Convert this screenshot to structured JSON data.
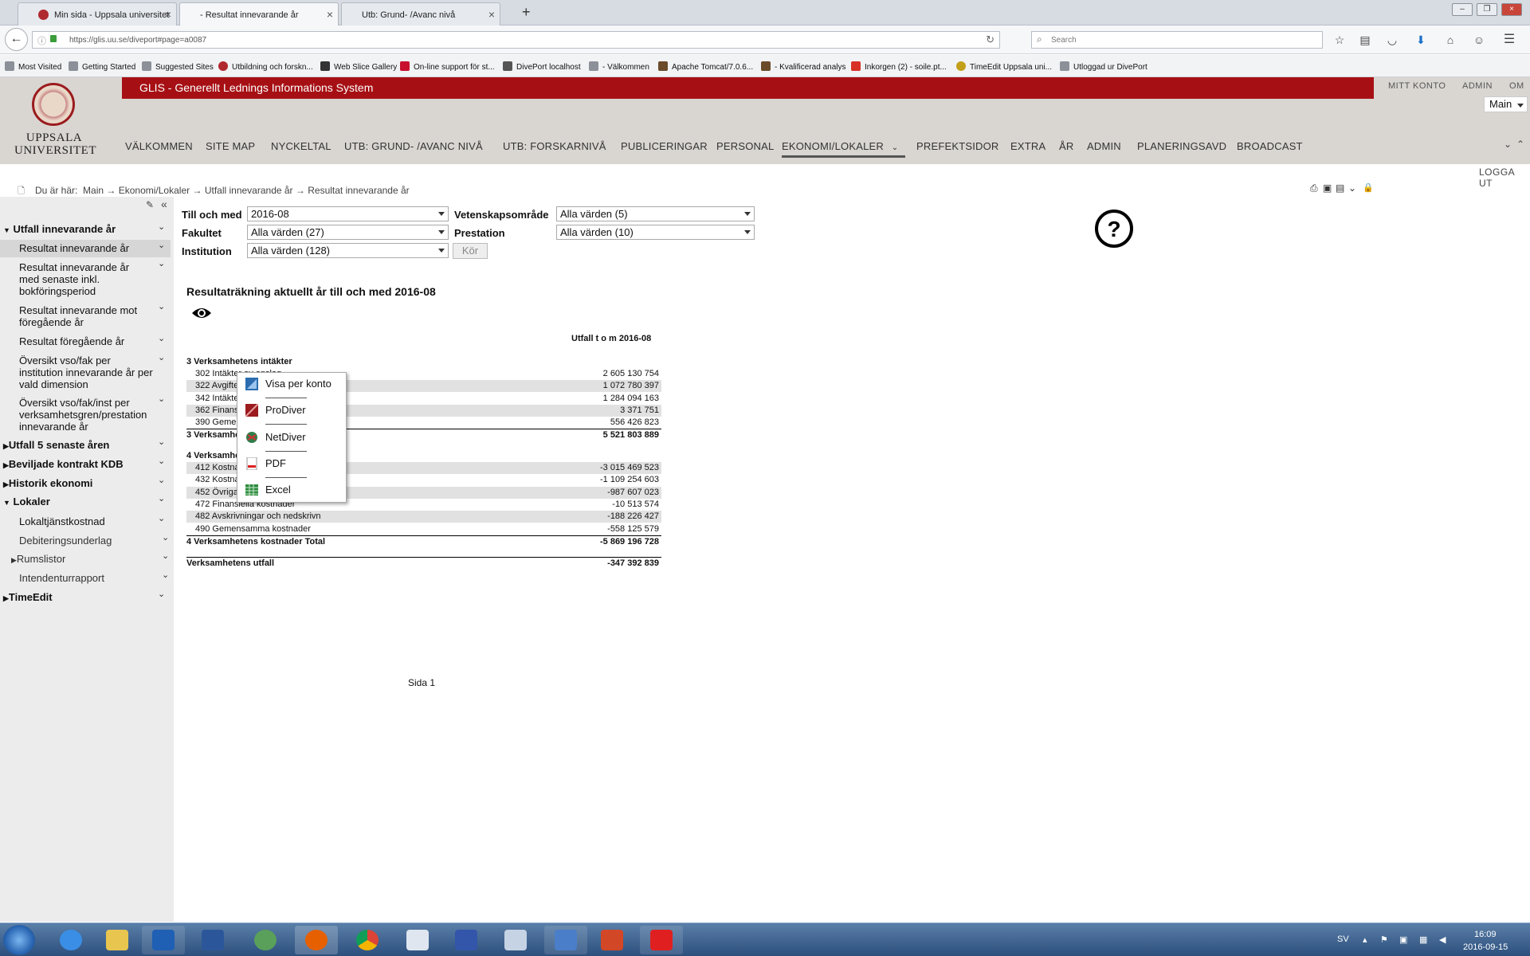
{
  "browser": {
    "tabs": [
      {
        "title": "Min sida - Uppsala universitet",
        "active": false
      },
      {
        "title": "- Resultat innevarande år",
        "active": true
      },
      {
        "title": "Utb: Grund- /Avanc nivå",
        "active": false
      }
    ],
    "new_tab": "+",
    "url": "https://glis.uu.se/diveport#page=a0087",
    "search_placeholder": "Search",
    "bookmarks": [
      "Most Visited",
      "Getting Started",
      "Suggested Sites",
      "Utbildning och forskn...",
      "Web Slice Gallery",
      "On-line support för st...",
      "DivePort localhost",
      "- Välkommen",
      "Apache Tomcat/7.0.6...",
      "- Kvalificerad analys",
      "Inkorgen (2) - soile.pt...",
      "TimeEdit Uppsala uni...",
      "Utloggad ur DivePort"
    ]
  },
  "site": {
    "logo_line1": "UPPSALA",
    "logo_line2": "UNIVERSITET",
    "system_title": "GLIS - Generellt Lednings Informations System",
    "top_links": [
      "MITT KONTO",
      "ADMIN",
      "OM"
    ],
    "main_select": "Main",
    "nav": [
      "VÄLKOMMEN",
      "SITE MAP",
      "NYCKELTAL",
      "UTB: GRUND- /AVANC NIVÅ",
      "UTB: FORSKARNIVÅ",
      "PUBLICERINGAR",
      "PERSONAL",
      "EKONOMI/LOKALER",
      "PREFEKTSIDOR",
      "EXTRA",
      "ÅR",
      "ADMIN",
      "PLANERINGSAVD",
      "BROADCAST"
    ],
    "nav_active": "EKONOMI/LOKALER",
    "logout": "LOGGA UT"
  },
  "breadcrumb": {
    "prefix": "Du är här:",
    "items": [
      "Main",
      "Ekonomi/Lokaler",
      "Utfall innevarande år",
      "Resultat innevarande år"
    ],
    "separator": "→"
  },
  "sidebar": {
    "items": [
      {
        "label": "Utfall innevarande år",
        "type": "group",
        "expanded": true
      },
      {
        "label": "Resultat innevarande år",
        "type": "item",
        "selected": true
      },
      {
        "label": "Resultat innevarande år med senaste inkl. bokföringsperiod",
        "type": "item"
      },
      {
        "label": "Resultat innevarande mot föregående år",
        "type": "item"
      },
      {
        "label": "Resultat föregående år",
        "type": "item"
      },
      {
        "label": "Översikt vso/fak per institution innevarande år per vald dimension",
        "type": "item"
      },
      {
        "label": "Översikt vso/fak/inst per verksamhetsgren/prestation innevarande år",
        "type": "item"
      },
      {
        "label": "Utfall 5 senaste åren",
        "type": "group",
        "expanded": false
      },
      {
        "label": "Beviljade kontrakt KDB",
        "type": "group",
        "expanded": false
      },
      {
        "label": "Historik ekonomi",
        "type": "group",
        "expanded": false
      },
      {
        "label": "Lokaler",
        "type": "group",
        "expanded": true
      },
      {
        "label": "Lokaltjänstkostnad",
        "type": "item"
      },
      {
        "label": "Debiteringsunderlag",
        "type": "item"
      },
      {
        "label": "Rumslistor",
        "type": "subgroup"
      },
      {
        "label": "Intendenturrapport",
        "type": "item"
      },
      {
        "label": "TimeEdit",
        "type": "group",
        "expanded": false
      }
    ]
  },
  "filters": {
    "till_och_med": {
      "label": "Till och med",
      "value": "2016-08"
    },
    "fakultet": {
      "label": "Fakultet",
      "value": "Alla värden (27)"
    },
    "institution": {
      "label": "Institution",
      "value": "Alla värden (128)"
    },
    "vetenskapsomrade": {
      "label": "Vetenskapsområde",
      "value": "Alla värden (5)"
    },
    "prestation": {
      "label": "Prestation",
      "value": "Alla värden (10)"
    },
    "run_button": "Kör"
  },
  "report": {
    "title": "Resultaträkning aktuellt år till och med 2016-08",
    "column_header": "Utfall t o m 2016-08",
    "rows": [
      {
        "label": "3 Verksamhetens intäkter",
        "value": "",
        "style": "section"
      },
      {
        "label": "302 Intäkter av anslag",
        "value": "2 605 130 754",
        "style": "plain"
      },
      {
        "label": "322 Avgifter",
        "value": "1 072 780 397",
        "style": "grey"
      },
      {
        "label": "342 Intäkter",
        "value": "1 284 094 163",
        "style": "plain"
      },
      {
        "label": "362 Finansiella",
        "value": "3 371 751",
        "style": "grey"
      },
      {
        "label": "390 Gemensamma",
        "value": "556 426 823",
        "style": "plain"
      },
      {
        "label": "3 Verksamhetens intäkter Total",
        "value": "5 521 803 889",
        "style": "total"
      },
      {
        "label": "4 Verksamhetens kostnader",
        "value": "",
        "style": "section"
      },
      {
        "label": "412 Kostnader",
        "value": "-3 015 469 523",
        "style": "grey"
      },
      {
        "label": "432 Kostnader",
        "value": "-1 109 254 603",
        "style": "plain"
      },
      {
        "label": "452 Övriga",
        "value": "-987 607 023",
        "style": "grey"
      },
      {
        "label": "472 Finansiella kostnader",
        "value": "-10 513 574",
        "style": "plain"
      },
      {
        "label": "482 Avskrivningar och nedskrivn",
        "value": "-188 226 427",
        "style": "grey"
      },
      {
        "label": "490 Gemensamma kostnader",
        "value": "-558 125 579",
        "style": "plain"
      },
      {
        "label": "4 Verksamhetens kostnader Total",
        "value": "-5 869 196 728",
        "style": "total"
      },
      {
        "label": "Verksamhetens utfall",
        "value": "-347 392 839",
        "style": "total"
      }
    ],
    "page_label": "Sida 1"
  },
  "context_menu": {
    "items": [
      "Visa per konto",
      "ProDiver",
      "NetDiver",
      "PDF",
      "Excel"
    ]
  },
  "taskbar": {
    "language": "SV",
    "time": "16:09",
    "date": "2016-09-15"
  },
  "colors": {
    "brand_red": "#a61014",
    "header_bg": "#d9d6d2",
    "sidebar_bg": "#ececec"
  }
}
